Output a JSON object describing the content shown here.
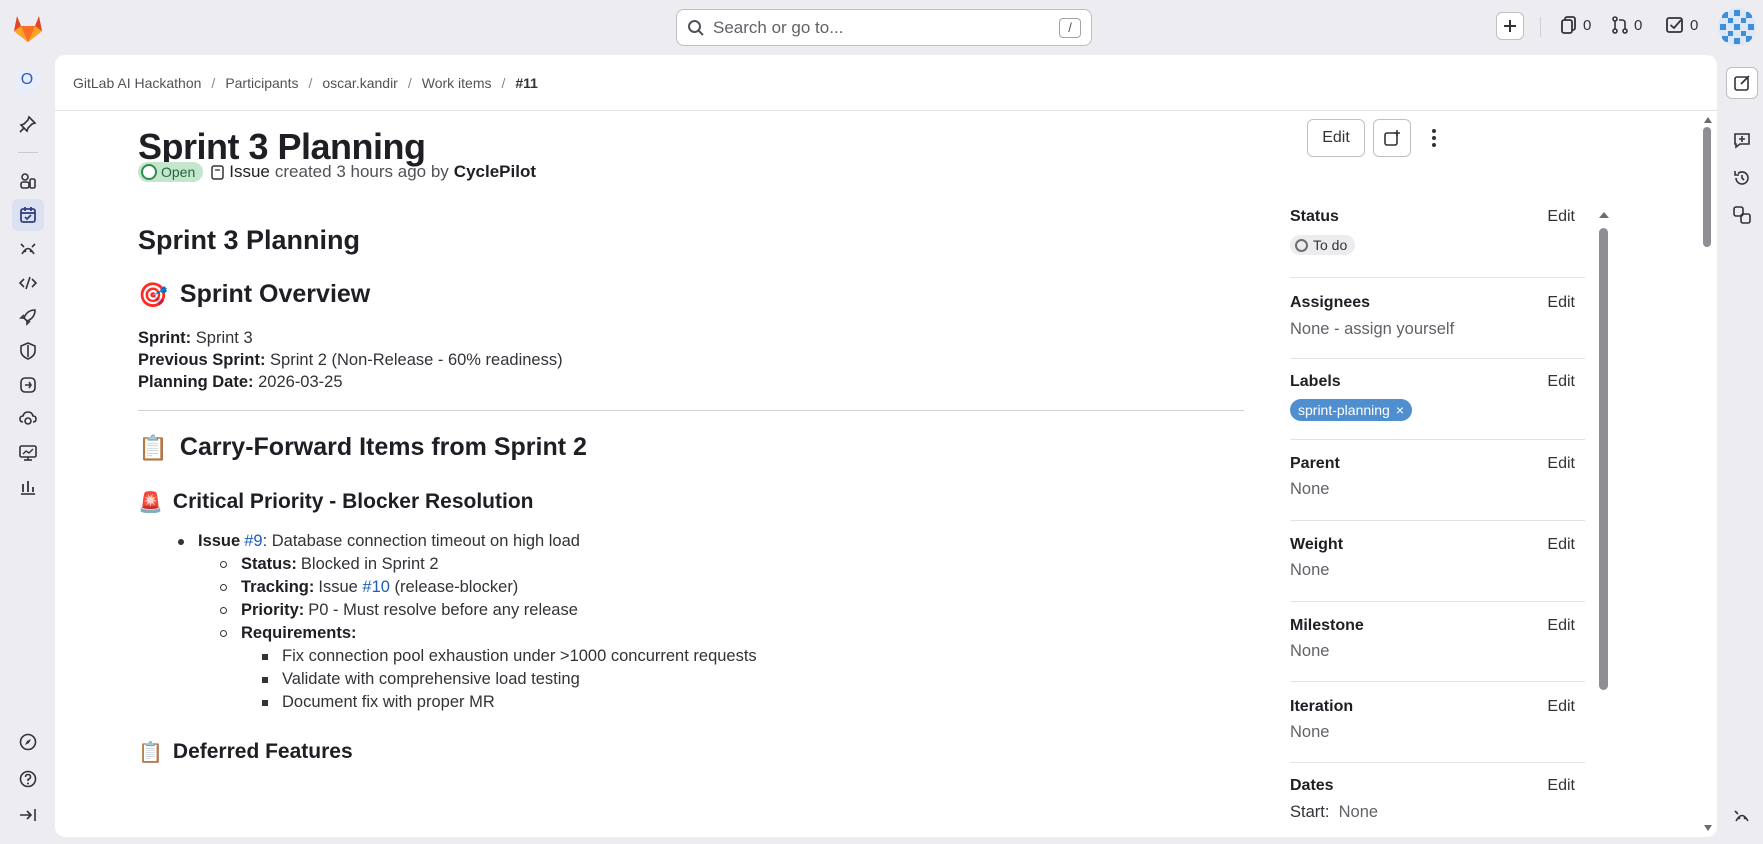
{
  "search": {
    "placeholder": "Search or go to...",
    "shortcut": "/"
  },
  "topbar": {
    "issues_count": "0",
    "merge_requests_count": "0",
    "todos_count": "0"
  },
  "leftnav": {
    "org_initial": "O"
  },
  "breadcrumb": [
    "GitLab AI Hackathon",
    "Participants",
    "oscar.kandir",
    "Work items",
    "#11"
  ],
  "header": {
    "title": "Sprint 3 Planning",
    "state": "Open",
    "type": "Issue",
    "created_text": "created 3 hours ago by",
    "author": "CyclePilot",
    "edit_label": "Edit"
  },
  "description": {
    "h1": "Sprint 3 Planning",
    "overview_emoji": "🎯",
    "overview_heading": "Sprint Overview",
    "sprint_label": "Sprint:",
    "sprint_value": "Sprint 3",
    "prev_label": "Previous Sprint:",
    "prev_value": "Sprint 2 (Non-Release - 60% readiness)",
    "date_label": "Planning Date:",
    "date_value": "2026-03-25",
    "carry_emoji": "📋",
    "carry_heading": "Carry-Forward Items from Sprint 2",
    "critical_emoji": "🚨",
    "critical_heading": "Critical Priority - Blocker Resolution",
    "issue_label": "Issue",
    "issue_ref": "#9",
    "issue_text": ": Database connection timeout on high load",
    "status_label": "Status:",
    "status_value": "Blocked in Sprint 2",
    "tracking_label": "Tracking:",
    "tracking_pre": "Issue",
    "tracking_ref": "#10",
    "tracking_post": "(release-blocker)",
    "priority_label": "Priority:",
    "priority_value": "P0 - Must resolve before any release",
    "requirements_label": "Requirements:",
    "requirements": [
      "Fix connection pool exhaustion under >1000 concurrent requests",
      "Validate with comprehensive load testing",
      "Document fix with proper MR"
    ],
    "deferred_emoji": "📋",
    "deferred_heading": "Deferred Features"
  },
  "sidebar": {
    "edit_label": "Edit",
    "status_title": "Status",
    "status_value": "To do",
    "assignees_title": "Assignees",
    "assignees_value": "None - assign yourself",
    "labels_title": "Labels",
    "label_value": "sprint-planning",
    "label_remove": "×",
    "parent_title": "Parent",
    "parent_value": "None",
    "weight_title": "Weight",
    "weight_value": "None",
    "milestone_title": "Milestone",
    "milestone_value": "None",
    "iteration_title": "Iteration",
    "iteration_value": "None",
    "dates_title": "Dates",
    "dates_start_label": "Start:",
    "dates_start_value": "None"
  },
  "colors": {
    "accent": "#1f5db8",
    "open_badge": "#c3e6cd",
    "label_pill": "#4f8fcf",
    "gitlab_orange": "#e24329"
  }
}
